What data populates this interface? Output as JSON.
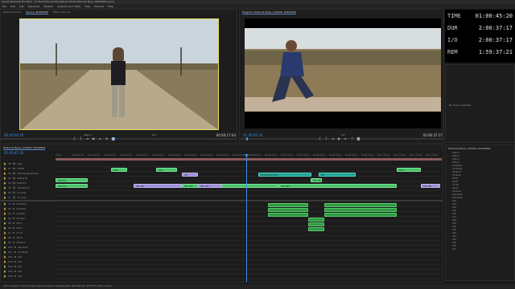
{
  "app": {
    "title": "Adobe Premiere Pro 2021 - D:\\The Holbrook Boys\\Project\\The Holbrook Boys 20220509.prproj",
    "menu": [
      "File",
      "Edit",
      "Clip",
      "Sequence",
      "Markers",
      "Graphics and Titles",
      "View",
      "Window",
      "Help"
    ]
  },
  "source": {
    "tabs": [
      "Media Browser",
      "Source: 2P3D3500",
      "Effect Controls"
    ],
    "timecode": "00:00:04:20",
    "fit": "Page 1",
    "full": "Full",
    "duration": "00:00:17:03"
  },
  "program": {
    "tab": "Program: Holbrook Boys | 2C0401 20220509",
    "timecode": "01:00:45:20",
    "fit": "1/4",
    "duration": "02:00:37:17"
  },
  "hud": [
    {
      "label": "TIME",
      "value": "01:00:45:20"
    },
    {
      "label": "DUR",
      "value": "2:00:37:17"
    },
    {
      "label": "I/O",
      "value": "2:00:37:17"
    },
    {
      "label": "REM",
      "value": "1:59:37:21"
    }
  ],
  "right_panel": {
    "title": "No items selected",
    "list_title": "Holbrook Boys | 2C0401 20220509",
    "rows": [
      "Clip A1",
      "Video 1",
      "Video 2",
      "Video 3",
      "A1 Dialog",
      "A2 Dialog",
      "A3 Music",
      "A4 Music",
      "A5 FX",
      "A6 FX",
      "A7 VO",
      "A8 VO",
      "A9 Room",
      "A10 Room",
      "A11 Music",
      "A12",
      "A13",
      "A14",
      "A15",
      "A16",
      "A17",
      "A18",
      "A19",
      "A20",
      "A21",
      "A22",
      "A23",
      "A24",
      "A25",
      "A26",
      "A27"
    ]
  },
  "timeline": {
    "tab": "Holbrook Boys | 2C0401 20220509",
    "timecode": "01:00:45:20",
    "ruler": [
      "00:00",
      "00:00:30:00",
      "00:01:00:00",
      "00:01:30:00",
      "00:02:00:00",
      "00:02:30:00",
      "00:03:00:00",
      "00:03:30:00",
      "00:04:00:00",
      "00:04:30:00",
      "00:05:00:00",
      "00:05:30:00",
      "00:06:00:00",
      "00:06:30:00",
      "00:07:00:00",
      "00:07:30:00",
      "00:08:00:00",
      "00:08:30:00",
      "00:09:00:00",
      "00:09:30:00",
      "00:10:00:00",
      "00:10:30:00",
      "00:11:00:00",
      "00:11:30:00"
    ],
    "video_tracks": [
      "V8",
      "V7",
      "V6",
      "V5",
      "V4",
      "V3",
      "V2",
      "V1"
    ],
    "video_names": [
      "Subs",
      "TITLES",
      "Camera Adjustments",
      "Effects FX",
      "B-Roll FX",
      "All Filters FX",
      "V2 Video",
      "V1 Video"
    ],
    "audio_tracks": [
      "A1",
      "A2",
      "A3",
      "A4",
      "A5",
      "A6",
      "A7",
      "A8",
      "A9",
      "A10",
      "A11",
      "A12",
      "A13",
      "A14",
      "A15",
      "A16"
    ],
    "audio_names": [
      "A1 Dialog",
      "A2 Dialog",
      "A3 Music",
      "A4 Music",
      "A5 FX",
      "A6 FX",
      "A7 VO",
      "A8 VO",
      "A9 Room",
      "A10 Room",
      "A11 Music",
      "A12",
      "A13",
      "A14",
      "A15",
      "A16"
    ],
    "clip_labels": [
      "Title",
      "Title",
      "Adj",
      "Adjustment Layer",
      "Adj",
      "Title",
      "Opening",
      "Clip_001",
      "Clip_002",
      "Clip_003"
    ]
  },
  "status_bar": "Click to select, or click in empty space and drag to marquee select. Use Shift, Alt, and Ctrl for other options.",
  "colors": {
    "accent": "#3b8fe6",
    "video_clip": "#47c16a",
    "nested": "#9d8fd8",
    "adjust": "#1fa291",
    "playhead": "#3b8fe6",
    "source_border": "#e5e05a"
  }
}
